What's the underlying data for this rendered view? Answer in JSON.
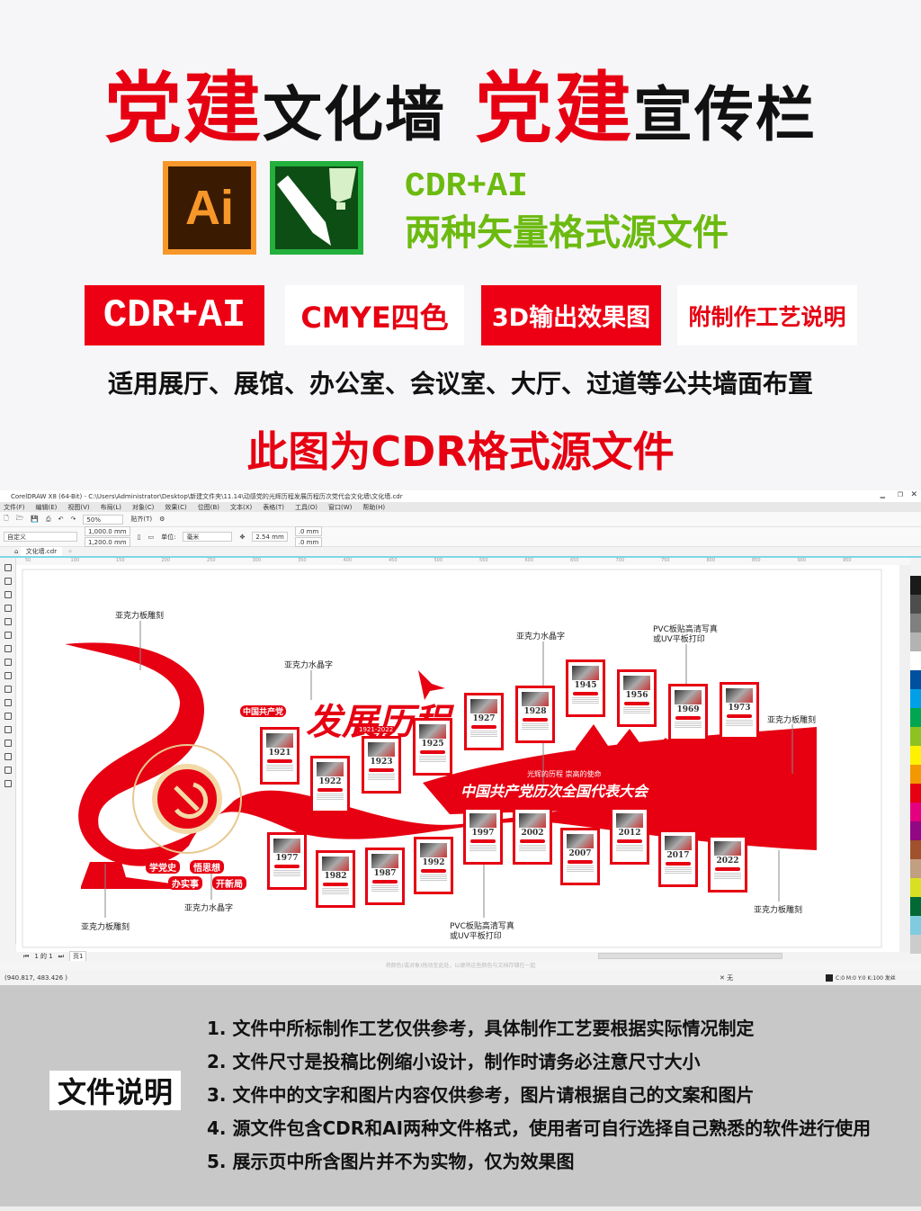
{
  "header": {
    "title_parts": [
      {
        "text": "党建",
        "style": "red"
      },
      {
        "text": "文化墙",
        "style": "black"
      },
      {
        "text": " 党建",
        "style": "red"
      },
      {
        "text": "宣传栏",
        "style": "black"
      }
    ],
    "ai_logo": "Ai",
    "format_line1": "CDR+AI",
    "format_line2": "两种矢量格式源文件",
    "badges": [
      "CDR+AI",
      "CMYE四色",
      "3D输出效果图",
      "附制作工艺说明"
    ],
    "usage": "适用展厅、展馆、办公室、会议室、大厅、过道等公共墙面布置",
    "note": "此图为CDR格式源文件"
  },
  "app": {
    "title": "CorelDRAW X8 (64-Bit) - C:\\Users\\Administrator\\Desktop\\新建文件夹\\11.14\\动感党的光辉历程发展历程历次党代会文化墙\\文化墙.cdr",
    "menu": [
      "文件(F)",
      "编辑(E)",
      "视图(V)",
      "布局(L)",
      "对象(C)",
      "效果(C)",
      "位图(B)",
      "文本(X)",
      "表格(T)",
      "工具(O)",
      "窗口(W)",
      "帮助(H)"
    ],
    "zoom": "50%",
    "snap": "贴齐(T)",
    "preset": "自定义",
    "width": "1,000.0 mm",
    "height": "1,200.0 mm",
    "unit_label": "单位:",
    "unit": "毫米",
    "nudge": "2.54 mm",
    "dup_x": ".0 mm",
    "dup_y": ".0 mm",
    "doc_tab": "文化墙.cdr",
    "ruler": [
      "50",
      "100",
      "150",
      "200",
      "250",
      "300",
      "350",
      "400",
      "450",
      "500",
      "550",
      "600",
      "650",
      "700",
      "750",
      "800",
      "850",
      "900",
      "950"
    ],
    "page_nav": "1 的 1",
    "page_tab": "页1",
    "hint": "将颜色(或对象)拖动至此处，以便将这些颜色与文档存储在一起",
    "coords": "(940.817, 483.426 )",
    "fill_none": "无",
    "outline": "C:0 M:0 Y:0 K:100 发丝",
    "palette": [
      "#1a1a1a",
      "#4d4d4d",
      "#808080",
      "#b3b3b3",
      "#ffffff",
      "#0050a0",
      "#00a0e9",
      "#00a650",
      "#8dc21f",
      "#fff100",
      "#f39800",
      "#e60012",
      "#e4007f",
      "#920783",
      "#a0522d",
      "#c0a080",
      "#d9e021",
      "#006934",
      "#7fcce0",
      "#ccc"
    ],
    "artwork": {
      "labels": {
        "l1": "亚克力板雕刻",
        "l2": "亚克力水晶字",
        "l3": "亚克力水晶字",
        "l4": "PVC板贴高清写真",
        "l4b": "或UV平板打印",
        "l5": "亚克力板雕刻",
        "l6": "亚克力板雕刻",
        "l7": "亚克力水晶字",
        "l8": "亚克力板雕刻",
        "l9": "PVC板贴高清写真",
        "l9b": "或UV平板打印"
      },
      "party_tag": "中国共产党",
      "calligraphy": "发展历程",
      "years_range": "1921-2022",
      "slogan_small": "光辉的历程 崇高的使命",
      "slogan_big": "中国共产党历次全国代表大会",
      "pills": [
        "学党史",
        "悟思想",
        "办实事",
        "开新局"
      ],
      "cards": [
        "1921",
        "1922",
        "1923",
        "1925",
        "1927",
        "1928",
        "1945",
        "1956",
        "1969",
        "1973",
        "1977",
        "1982",
        "1987",
        "1992",
        "1997",
        "2002",
        "2007",
        "2012",
        "2017",
        "2022"
      ]
    }
  },
  "notes": {
    "title": "文件说明",
    "items": [
      "1. 文件中所标制作工艺仅供参考，具体制作工艺要根据实际情况制定",
      "2. 文件尺寸是投稿比例缩小设计，制作时请务必注意尺寸大小",
      "3. 文件中的文字和图片内容仅供参考，图片请根据自己的文案和图片",
      "4. 源文件包含CDR和AI两种文件格式，使用者可自行选择自己熟悉的软件进行使用",
      "5. 展示页中所含图片并不为实物，仅为效果图"
    ]
  }
}
